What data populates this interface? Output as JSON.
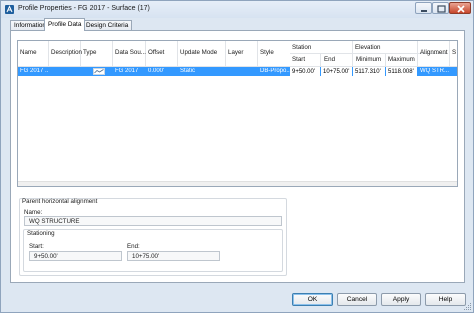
{
  "window": {
    "title": "Profile Properties - FG 2017 - Surface (17)"
  },
  "tabs": [
    {
      "label": "Information",
      "active": false
    },
    {
      "label": "Profile Data",
      "active": true
    },
    {
      "label": "Design Criteria",
      "active": false
    }
  ],
  "table": {
    "columns": {
      "name": "Name",
      "description": "Description",
      "type": "Type",
      "data_source": "Data Sou...",
      "offset": "Offset",
      "update_mode": "Update Mode",
      "layer": "Layer",
      "style": "Style",
      "station": "Station",
      "station_start": "Start",
      "station_end": "End",
      "elevation": "Elevation",
      "elevation_min": "Minimum",
      "elevation_max": "Maximum",
      "alignment": "Alignment",
      "s": "S"
    },
    "rows": [
      {
        "name": "FG 2017 ...",
        "description": "",
        "type_icon": "surface-profile-icon",
        "data_source": "FG 2017",
        "offset": "0.000'",
        "update_mode": "Static",
        "layer": "",
        "style": "DB-Propo...",
        "station_start": "9+50.00'",
        "station_end": "10+75.00'",
        "elevation_min": "5117.310'",
        "elevation_max": "5118.008'",
        "alignment": "WQ STR..."
      }
    ]
  },
  "parent_alignment": {
    "group_label": "Parent horizontal alignment",
    "name_label": "Name:",
    "name_value": "WQ STRUCTURE",
    "stationing_label": "Stationing",
    "start_label": "Start:",
    "start_value": "9+50.00'",
    "end_label": "End:",
    "end_value": "10+75.00'"
  },
  "buttons": {
    "ok": "OK",
    "cancel": "Cancel",
    "apply": "Apply",
    "help": "Help"
  },
  "colors": {
    "selection": "#3399ff",
    "close": "#c7462b",
    "window_bg": "#dde7f2"
  }
}
